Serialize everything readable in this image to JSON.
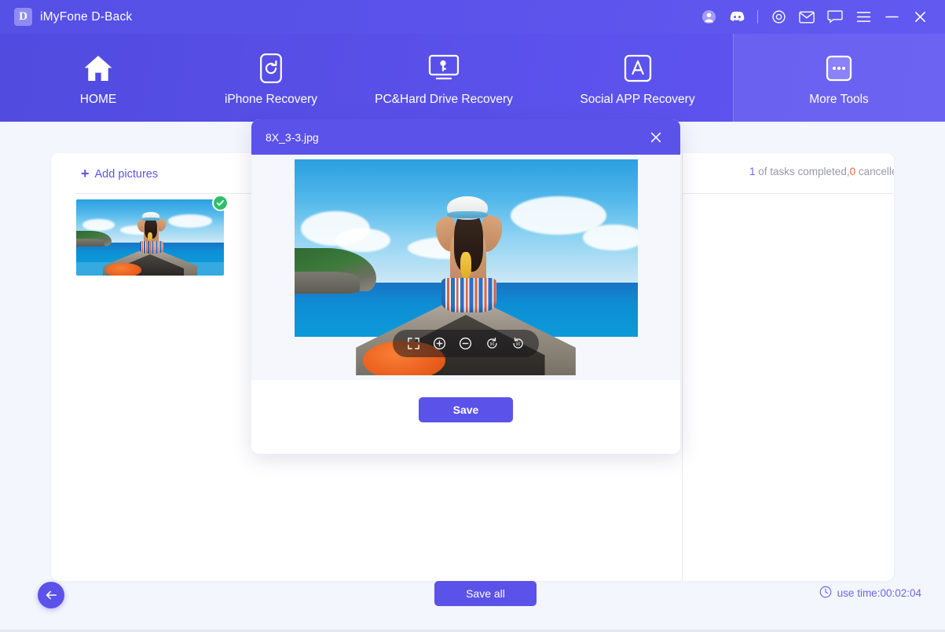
{
  "titlebar": {
    "brand_letter": "D",
    "app_name": "iMyFone D-Back",
    "icons": [
      {
        "name": "account-avatar-icon",
        "label": "Account"
      },
      {
        "name": "discord-icon",
        "label": "Discord"
      },
      {
        "name": "target-settings-icon",
        "label": "Settings"
      },
      {
        "name": "mail-icon",
        "label": "Mail"
      },
      {
        "name": "feedback-chat-icon",
        "label": "Feedback"
      },
      {
        "name": "menu-hamburger-icon",
        "label": "Menu"
      },
      {
        "name": "minimize-icon",
        "label": "Minimize"
      },
      {
        "name": "close-icon",
        "label": "Close"
      }
    ]
  },
  "nav": {
    "items": [
      {
        "label": "HOME",
        "icon": "home-icon"
      },
      {
        "label": "iPhone Recovery",
        "icon": "iphone-refresh-icon"
      },
      {
        "label": "PC&Hard Drive Recovery",
        "icon": "monitor-key-icon"
      },
      {
        "label": "Social APP Recovery",
        "icon": "appstore-icon"
      },
      {
        "label": "More Tools",
        "icon": "ellipsis-box-icon"
      }
    ],
    "active": "More Tools"
  },
  "main": {
    "add_pictures_label": "Add pictures",
    "add_pictures_plus": "+",
    "status": {
      "completed_count": "1",
      "text_middle": " of tasks completed,",
      "cancelled_count": "0",
      "text_end": " cancelled"
    },
    "thumbnail": {
      "name": "beach-boat-photo-thumbnail",
      "selected_check": "✓"
    }
  },
  "modal": {
    "title": "8X_3-3.jpg",
    "close_glyph": "✕",
    "save_label": "Save",
    "image_toolbar": [
      {
        "name": "fit-screen-icon",
        "label": "Fit to screen"
      },
      {
        "name": "zoom-in-icon",
        "label": "Zoom in"
      },
      {
        "name": "zoom-out-icon",
        "label": "Zoom out"
      },
      {
        "name": "rotate-left-90-icon",
        "label": "Rotate left 90"
      },
      {
        "name": "rotate-right-90-icon",
        "label": "Rotate right 90"
      }
    ]
  },
  "footer": {
    "back_label": "Back",
    "save_all_label": "Save all",
    "use_time_label": "use time:00:02:04",
    "clock_icon": "clock-icon"
  },
  "colors": {
    "brand_purple": "#5b52ea",
    "header_gradient_start": "#514bdf",
    "header_gradient_end": "#6055f2",
    "page_background": "#f3f6fd",
    "card_white": "#ffffff",
    "status_done": "#6b64ea",
    "status_cancelled": "#f2693c",
    "check_green": "#2fc06a",
    "muted_text": "#9a9aa8"
  }
}
